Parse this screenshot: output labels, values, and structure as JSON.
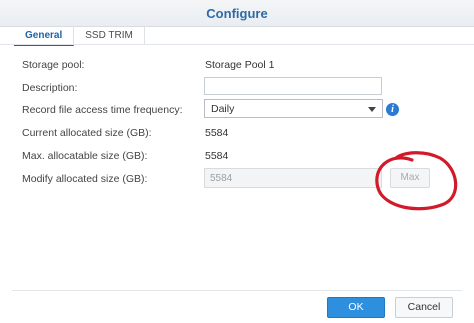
{
  "dialog": {
    "title": "Configure"
  },
  "tabs": [
    {
      "label": "General",
      "active": true
    },
    {
      "label": "SSD TRIM",
      "active": false
    }
  ],
  "form": {
    "storage_pool": {
      "label": "Storage pool:",
      "value": "Storage Pool 1"
    },
    "description": {
      "label": "Description:",
      "value": ""
    },
    "record_access_time": {
      "label": "Record file access time frequency:",
      "value": "Daily"
    },
    "current_allocated": {
      "label": "Current allocated size (GB):",
      "value": "5584"
    },
    "max_allocatable": {
      "label": "Max. allocatable size (GB):",
      "value": "5584"
    },
    "modify_allocated": {
      "label": "Modify allocated size (GB):",
      "value": "5584",
      "max_label": "Max"
    }
  },
  "footer": {
    "ok_label": "OK",
    "cancel_label": "Cancel"
  },
  "colors": {
    "accent": "#2e8fdf",
    "title": "#2f6aa7",
    "annotation": "#d11a2a"
  },
  "icons": {
    "info": "info-icon",
    "dropdown": "chevron-down-icon"
  }
}
